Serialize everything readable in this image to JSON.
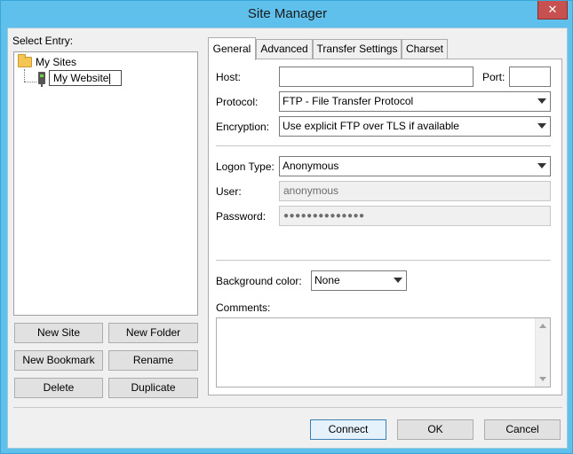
{
  "window": {
    "title": "Site Manager",
    "close_glyph": "✕"
  },
  "left": {
    "select_entry_label": "Select Entry:",
    "tree": {
      "root_label": "My Sites",
      "child_edit_value": "My Website"
    },
    "buttons": {
      "new_site": "New Site",
      "new_folder": "New Folder",
      "new_bookmark": "New Bookmark",
      "rename": "Rename",
      "delete": "Delete",
      "duplicate": "Duplicate"
    }
  },
  "tabs": [
    "General",
    "Advanced",
    "Transfer Settings",
    "Charset"
  ],
  "general": {
    "host_label": "Host:",
    "host_value": "",
    "port_label": "Port:",
    "port_value": "",
    "protocol_label": "Protocol:",
    "protocol_value": "FTP - File Transfer Protocol",
    "encryption_label": "Encryption:",
    "encryption_value": "Use explicit FTP over TLS if available",
    "logon_type_label": "Logon Type:",
    "logon_type_value": "Anonymous",
    "user_label": "User:",
    "user_value": "anonymous",
    "password_label": "Password:",
    "password_value": "●●●●●●●●●●●●●●",
    "bg_color_label": "Background color:",
    "bg_color_value": "None",
    "comments_label": "Comments:",
    "comments_value": ""
  },
  "footer": {
    "connect": "Connect",
    "ok": "OK",
    "cancel": "Cancel"
  },
  "colors": {
    "frame": "#5fc0eb",
    "close": "#c75050",
    "dialog_bg": "#f0f0f0"
  },
  "icons": [
    "close-icon",
    "folder-icon",
    "server-icon",
    "dropdown-arrow-icon",
    "scroll-up-icon",
    "scroll-down-icon"
  ]
}
